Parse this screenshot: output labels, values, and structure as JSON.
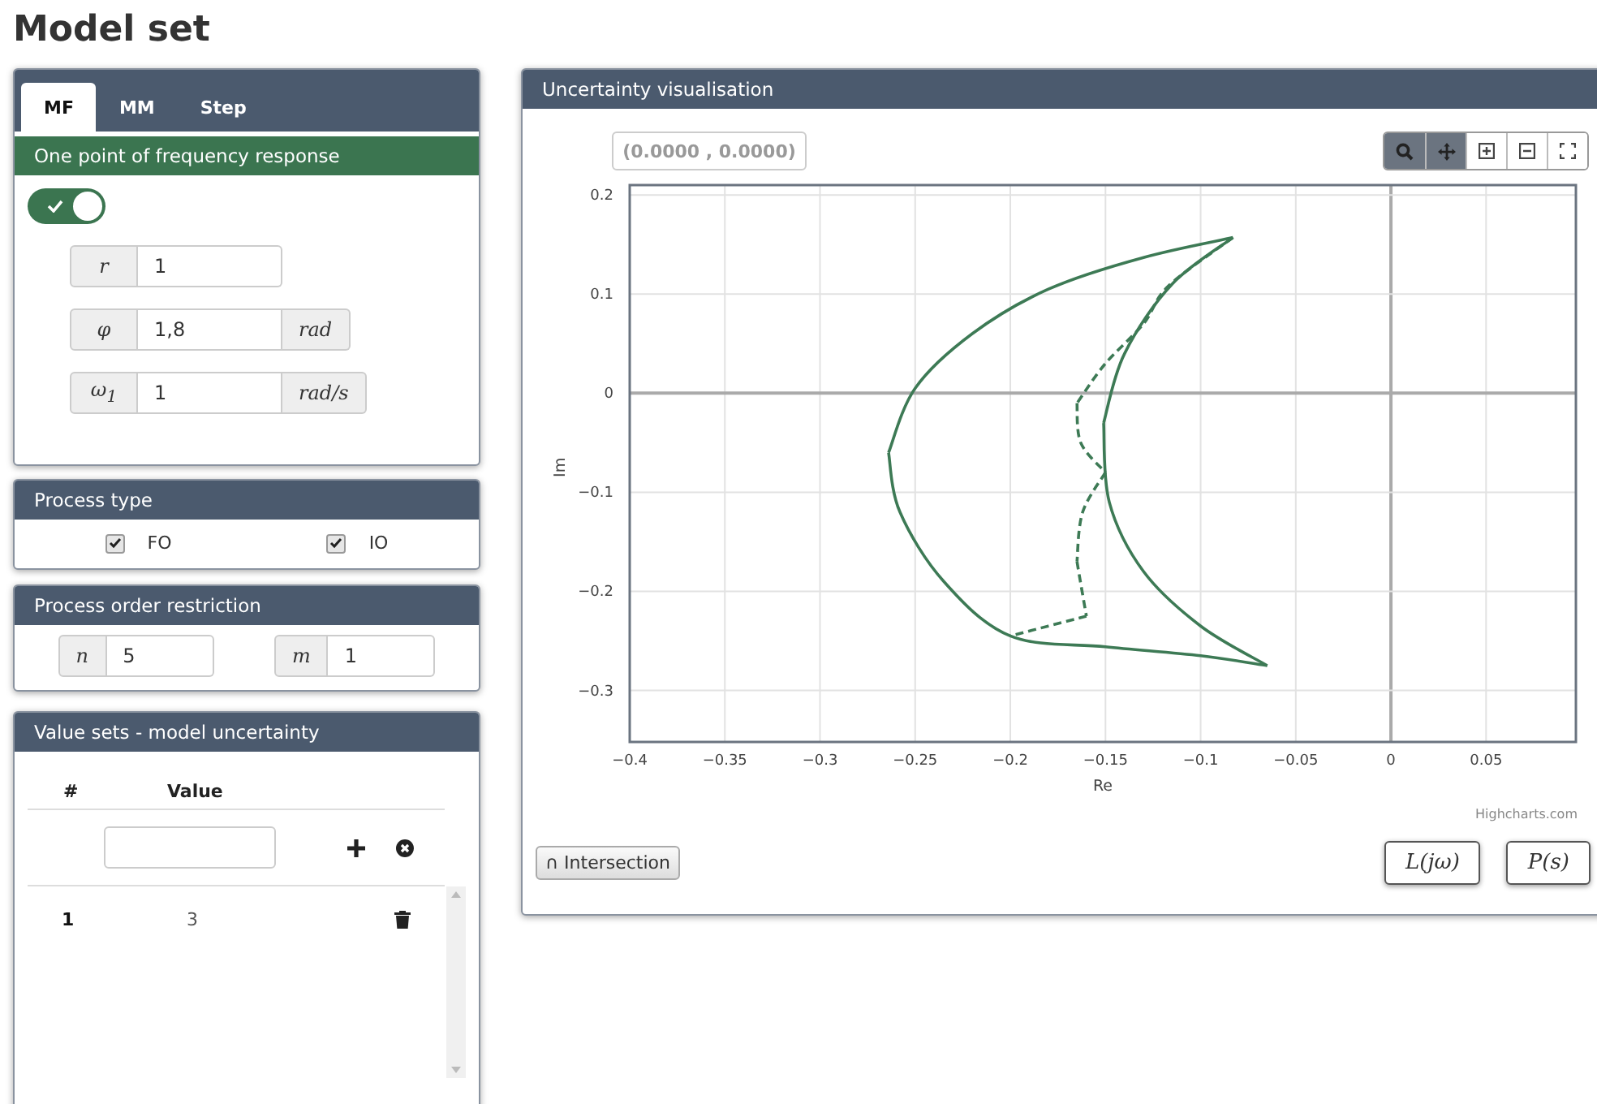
{
  "page_title": "Model set",
  "tabs": [
    {
      "label": "MF",
      "selected": true
    },
    {
      "label": "MM",
      "selected": false
    },
    {
      "label": "Step",
      "selected": false
    }
  ],
  "frequency_point": {
    "title": "One point of frequency response",
    "enabled": true,
    "fields": [
      {
        "symbol": "r",
        "value": "1"
      },
      {
        "symbol": "φ",
        "value": "1,8",
        "unit": "rad"
      },
      {
        "symbol": "ω$_{1}$",
        "value": "1",
        "unit": "rad/s"
      }
    ]
  },
  "process_type": {
    "title": "Process type",
    "options": [
      {
        "label": "FO",
        "checked": true
      },
      {
        "label": "IO",
        "checked": true
      }
    ]
  },
  "order_restriction": {
    "title": "Process order restriction",
    "fields": [
      {
        "symbol": "n",
        "value": "5"
      },
      {
        "symbol": "m",
        "value": "1"
      }
    ]
  },
  "value_sets": {
    "title": "Value sets - model uncertainty",
    "columns": [
      "#",
      "Value"
    ],
    "rows": [
      {
        "index": "1",
        "value": "3"
      }
    ]
  },
  "visualisation": {
    "title": "Uncertainty visualisation",
    "coordinates": "(0.0000 , 0.0000)",
    "tools": [
      {
        "kind": "zoom",
        "selected": true
      },
      {
        "kind": "pan",
        "selected": true
      },
      {
        "kind": "zoom_in",
        "selected": false
      },
      {
        "kind": "zoom_out",
        "selected": false
      },
      {
        "kind": "fullscreen",
        "selected": false
      }
    ],
    "chart_data": {
      "type": "line",
      "grid": true,
      "xlabel": "Re",
      "ylabel": "Im",
      "xlim": [
        -0.4,
        0.0972
      ],
      "ylim": [
        -0.352,
        0.21
      ],
      "xticks": [
        {
          "value": -0.4,
          "label": "−0.4"
        },
        {
          "value": -0.35,
          "label": "−0.35"
        },
        {
          "value": -0.3,
          "label": "−0.3"
        },
        {
          "value": -0.25,
          "label": "−0.25"
        },
        {
          "value": -0.2,
          "label": "−0.2"
        },
        {
          "value": -0.15,
          "label": "−0.15"
        },
        {
          "value": -0.1,
          "label": "−0.1"
        },
        {
          "value": -0.05,
          "label": "−0.05"
        },
        {
          "value": 0,
          "label": "0"
        },
        {
          "value": 0.05,
          "label": "0.05"
        }
      ],
      "yticks": [
        {
          "value": 0.2,
          "label": "0.2"
        },
        {
          "value": 0.1,
          "label": "0.1"
        },
        {
          "value": 0,
          "label": "0"
        },
        {
          "value": -0.1,
          "label": "−0.1"
        },
        {
          "value": -0.2,
          "label": "−0.2"
        },
        {
          "value": -0.3,
          "label": "−0.3"
        }
      ],
      "series": [
        {
          "color": "#3d7a55",
          "line_style": "solid",
          "x": [
            -0.083,
            -0.13,
            -0.18,
            -0.22,
            -0.25,
            -0.264
          ],
          "values": [
            0.157,
            0.137,
            0.105,
            0.06,
            0.005,
            -0.06
          ]
        },
        {
          "color": "#3d7a55",
          "line_style": "solid",
          "x": [
            -0.264,
            -0.258,
            -0.235,
            -0.2,
            -0.15,
            -0.1,
            -0.065
          ],
          "values": [
            -0.06,
            -0.12,
            -0.19,
            -0.245,
            -0.256,
            -0.265,
            -0.275
          ]
        },
        {
          "color": "#3d7a55",
          "line_style": "solid",
          "x": [
            -0.065,
            -0.1,
            -0.13,
            -0.148,
            -0.151
          ],
          "values": [
            -0.275,
            -0.235,
            -0.18,
            -0.11,
            -0.03
          ]
        },
        {
          "color": "#3d7a55",
          "line_style": "solid",
          "x": [
            -0.151,
            -0.14,
            -0.115,
            -0.083
          ],
          "values": [
            -0.03,
            0.04,
            0.11,
            0.157
          ]
        },
        {
          "color": "#3d7a55",
          "line_style": "dashed",
          "x": [
            -0.083,
            -0.117,
            -0.13,
            -0.15,
            -0.165
          ],
          "values": [
            0.157,
            0.108,
            0.07,
            0.03,
            -0.01
          ]
        },
        {
          "color": "#3d7a55",
          "line_style": "dashed",
          "x": [
            -0.165,
            -0.163,
            -0.15
          ],
          "values": [
            -0.01,
            -0.05,
            -0.08
          ]
        },
        {
          "color": "#3d7a55",
          "line_style": "dashed",
          "x": [
            -0.15,
            -0.162,
            -0.165
          ],
          "values": [
            -0.08,
            -0.12,
            -0.17
          ]
        },
        {
          "color": "#3d7a55",
          "line_style": "dashed",
          "x": [
            -0.165,
            -0.16
          ],
          "values": [
            -0.17,
            -0.225
          ]
        },
        {
          "color": "#3d7a55",
          "line_style": "dashed",
          "x": [
            -0.16,
            -0.2
          ],
          "values": [
            -0.225,
            -0.245
          ]
        }
      ]
    },
    "credit": "Highcharts.com",
    "buttons": [
      {
        "kind": "intersection",
        "label": "∩ Intersection"
      },
      {
        "kind": "math",
        "label": "L(jω)"
      },
      {
        "kind": "math",
        "label": "P(s)"
      }
    ]
  }
}
